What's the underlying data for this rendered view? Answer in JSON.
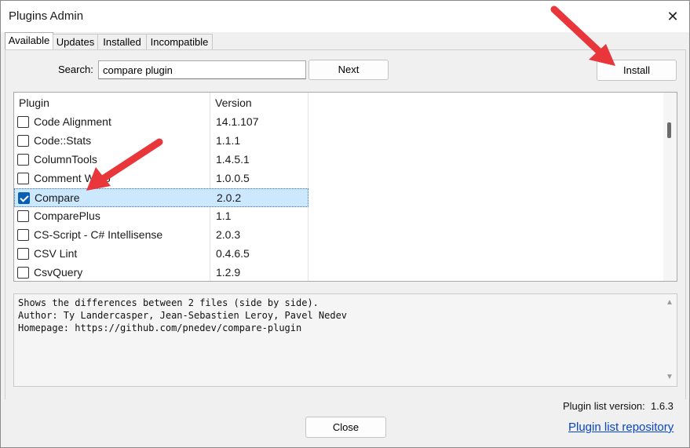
{
  "window": {
    "title": "Plugins Admin"
  },
  "tabs": [
    {
      "label": "Available",
      "active": true
    },
    {
      "label": "Updates",
      "active": false
    },
    {
      "label": "Installed",
      "active": false
    },
    {
      "label": "Incompatible",
      "active": false
    }
  ],
  "search": {
    "label": "Search:",
    "value": "compare plugin"
  },
  "buttons": {
    "next": "Next",
    "install": "Install",
    "close": "Close"
  },
  "list": {
    "columns": [
      "Plugin",
      "Version"
    ],
    "rows": [
      {
        "name": "Code Alignment",
        "version": "14.1.107",
        "checked": false,
        "selected": false
      },
      {
        "name": "Code::Stats",
        "version": "1.1.1",
        "checked": false,
        "selected": false
      },
      {
        "name": "ColumnTools",
        "version": "1.4.5.1",
        "checked": false,
        "selected": false
      },
      {
        "name": "Comment Wrap",
        "version": "1.0.0.5",
        "checked": false,
        "selected": false
      },
      {
        "name": "Compare",
        "version": "2.0.2",
        "checked": true,
        "selected": true
      },
      {
        "name": "ComparePlus",
        "version": "1.1",
        "checked": false,
        "selected": false
      },
      {
        "name": "CS-Script - C# Intellisense",
        "version": "2.0.3",
        "checked": false,
        "selected": false
      },
      {
        "name": "CSV Lint",
        "version": "0.4.6.5",
        "checked": false,
        "selected": false
      },
      {
        "name": "CsvQuery",
        "version": "1.2.9",
        "checked": false,
        "selected": false
      }
    ]
  },
  "description": {
    "lines": [
      "Shows the differences between 2 files (side by side).",
      "Author: Ty Landercasper, Jean-Sebastien Leroy, Pavel Nedev",
      "Homepage: https://github.com/pnedev/compare-plugin"
    ]
  },
  "footer": {
    "plugin_list_version_label": "Plugin list version:",
    "plugin_list_version": "1.6.3",
    "repo_link": "Plugin list repository"
  },
  "colors": {
    "annotation_arrow": "#e8363b",
    "selection": "#cce8ff",
    "link": "#0645c9"
  }
}
